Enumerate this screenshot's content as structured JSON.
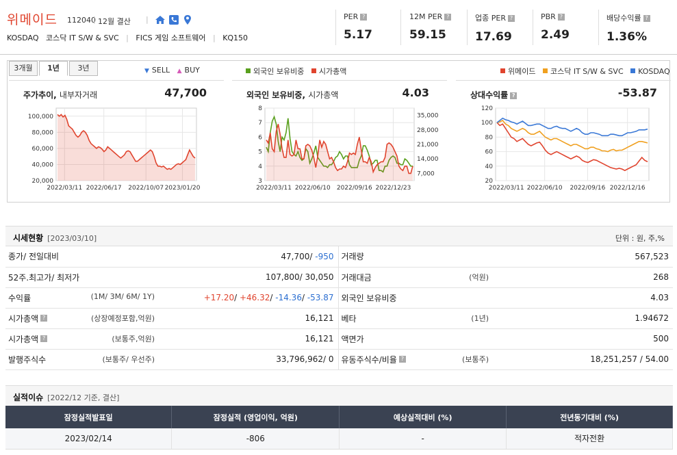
{
  "company": {
    "name": "위메이드",
    "code": "112040",
    "fiscal": "12월 결산",
    "market": "KOSDAQ",
    "industry": "코스닥 IT S/W & SVC",
    "fics": "FICS 게임 소프트웨어",
    "index": "KQ150"
  },
  "icons": [
    "home-icon",
    "phone-icon",
    "location-pin-icon",
    "help-icon"
  ],
  "metrics": [
    {
      "label": "PER",
      "value": "5.17"
    },
    {
      "label": "12M PER",
      "value": "59.15"
    },
    {
      "label": "업종 PER",
      "value": "17.69"
    },
    {
      "label": "PBR",
      "value": "2.49"
    },
    {
      "label": "배당수익률",
      "value": "1.36%"
    }
  ],
  "tabs": [
    "3개월",
    "1년",
    "3년"
  ],
  "active_tab": "1년",
  "legends": {
    "trade": [
      "SELL",
      "BUY"
    ],
    "foreign": [
      "외국인 보유비중",
      "시가총액"
    ],
    "relative": [
      "위메이드",
      "코스닥 IT S/W & SVC",
      "KOSDAQ"
    ]
  },
  "colors": {
    "red": "#e0442e",
    "green": "#5aa01e",
    "orange": "#f0a020",
    "blue": "#3a78d6",
    "sell": "#3a78d6",
    "buy": "#d65ab8"
  },
  "chart_data": [
    {
      "type": "area",
      "title": "주가추이",
      "subtitle": "내부자거래",
      "headline": "47,700",
      "x_ticks": [
        "2022/03/11",
        "2022/06/17",
        "2022/10/07",
        "2023/01/20"
      ],
      "y_ticks": [
        "100,000",
        "80,000",
        "60,000",
        "40,000",
        "20,000"
      ],
      "ylim": [
        20000,
        110000
      ],
      "series": [
        {
          "name": "위메이드",
          "values": [
            102000,
            100000,
            102000,
            99000,
            101000,
            96000,
            88000,
            86000,
            84000,
            80000,
            76000,
            74000,
            76000,
            80000,
            82000,
            80000,
            76000,
            70000,
            66000,
            64000,
            62000,
            60000,
            62000,
            61000,
            59000,
            56000,
            58000,
            62000,
            60000,
            58000,
            56000,
            54000,
            52000,
            50000,
            48000,
            50000,
            52000,
            56000,
            57000,
            56000,
            52000,
            48000,
            44000,
            44000,
            46000,
            48000,
            50000,
            52000,
            54000,
            56000,
            58000,
            56000,
            50000,
            42000,
            38000,
            38000,
            37000,
            38000,
            36000,
            34000,
            35000,
            34000,
            36000,
            38000,
            40000,
            41000,
            40000,
            42000,
            44000,
            46000,
            52000,
            58000,
            54000,
            50000,
            48000
          ]
        }
      ]
    },
    {
      "type": "line",
      "title": "외국인 보유비중",
      "subtitle": "시가총액",
      "headline": "4.03",
      "x_ticks": [
        "2022/03/11",
        "2022/06/10",
        "2022/09/16",
        "2022/12/23"
      ],
      "y_ticks": [
        "8",
        "7",
        "6",
        "5",
        "4",
        "3"
      ],
      "y2_ticks": [
        "35,000",
        "28,000",
        "21,000",
        "14,000",
        "7,000"
      ],
      "ylim": [
        3,
        8
      ],
      "series": [
        {
          "name": "외국인 보유비중",
          "values": [
            5.3,
            5.0,
            6.3,
            7.1,
            7.4,
            6.9,
            5.7,
            5.0,
            6.0,
            5.8,
            6.3,
            7.3,
            5.9,
            5.0,
            4.8,
            4.7,
            5.0,
            4.6,
            4.4,
            4.5,
            5.2,
            5.0,
            4.2,
            4.5,
            4.9,
            5.4,
            4.6,
            4.4,
            4.2,
            4.0,
            4.0,
            3.9,
            4.1,
            4.1,
            4.3,
            4.6,
            4.7,
            5.0,
            4.8,
            4.5,
            4.7,
            4.7,
            4.1,
            3.9,
            3.9,
            3.9,
            3.9,
            4.4,
            4.7,
            5.4,
            5.4,
            5.1,
            4.7,
            4.1,
            4.2,
            4.4,
            4.4,
            3.7,
            3.7,
            3.6,
            4.0,
            4.0,
            4.4,
            4.6,
            4.7,
            4.6,
            4.2,
            4.2,
            4.1,
            4.1,
            4.5,
            4.4,
            4.2,
            4.0,
            4.0
          ]
        },
        {
          "name": "시가총액",
          "values": [
            5.8,
            5.6,
            6.3,
            5.2,
            5.0,
            6.4,
            6.9,
            6.2,
            5.2,
            4.6,
            4.6,
            5.8,
            4.8,
            4.7,
            4.8,
            5.8,
            5.2,
            5.2,
            4.5,
            4.5,
            5.4,
            5.5,
            5.4,
            5.1,
            4.6,
            3.9,
            4.7,
            5.8,
            5.3,
            5.7,
            5.5,
            5.0,
            4.5,
            4.6,
            4.3,
            3.9,
            3.7,
            3.8,
            3.8,
            4.0,
            3.9,
            4.3,
            4.9,
            4.8,
            4.9,
            4.8,
            5.5,
            6.0,
            5.1,
            4.3,
            4.3,
            4.2,
            4.6,
            4.3,
            3.6,
            3.9,
            4.1,
            4.2,
            4.3,
            4.3,
            4.6,
            5.5,
            5.6,
            5.5,
            5.3,
            5.0,
            4.7,
            4.0,
            3.8,
            3.7,
            4.0,
            4.0,
            3.5,
            3.5,
            4.0
          ]
        }
      ]
    },
    {
      "type": "line",
      "title": "상대수익률",
      "headline": "-53.87",
      "x_ticks": [
        "2022/03/11",
        "2022/06/10",
        "2022/09/16",
        "2022/12/16"
      ],
      "y_ticks": [
        "120",
        "100",
        "80",
        "60",
        "40",
        "20"
      ],
      "ylim": [
        20,
        120
      ],
      "series": [
        {
          "name": "위메이드",
          "values": [
            100,
            96,
            98,
            92,
            86,
            80,
            78,
            74,
            76,
            78,
            74,
            70,
            68,
            70,
            72,
            73,
            68,
            62,
            58,
            56,
            58,
            60,
            58,
            56,
            54,
            52,
            50,
            52,
            54,
            52,
            48,
            46,
            45,
            47,
            49,
            48,
            46,
            44,
            42,
            40,
            38,
            37,
            36,
            37,
            36,
            34,
            36,
            38,
            40,
            42,
            47,
            52,
            48,
            46
          ]
        },
        {
          "name": "코스닥 IT S/W & SVC",
          "values": [
            100,
            101,
            103,
            98,
            96,
            92,
            90,
            88,
            90,
            92,
            90,
            86,
            84,
            84,
            86,
            88,
            84,
            80,
            78,
            76,
            78,
            78,
            76,
            74,
            72,
            70,
            68,
            70,
            70,
            68,
            66,
            64,
            64,
            66,
            66,
            64,
            63,
            61,
            61,
            60,
            62,
            63,
            61,
            62,
            62,
            64,
            66,
            68,
            70,
            72,
            74,
            74,
            73,
            72
          ]
        },
        {
          "name": "KOSDAQ",
          "values": [
            100,
            103,
            106,
            104,
            103,
            101,
            100,
            98,
            100,
            102,
            99,
            96,
            96,
            97,
            98,
            98,
            96,
            94,
            92,
            92,
            94,
            95,
            93,
            92,
            92,
            90,
            88,
            90,
            92,
            90,
            86,
            84,
            84,
            86,
            86,
            85,
            84,
            82,
            82,
            82,
            84,
            84,
            83,
            82,
            82,
            84,
            86,
            86,
            87,
            88,
            90,
            90,
            90,
            91
          ]
        }
      ]
    }
  ],
  "market_status": {
    "title": "시세현황",
    "date": "[2023/03/10]",
    "unit": "단위 : 원, 주,%",
    "rows": [
      {
        "l_label": "종가/ 전일대비",
        "l_sub": "",
        "l_val_main": "47,700/",
        "l_val_extra": " -950",
        "r_label": "거래량",
        "r_sub": "",
        "r_val": "567,523"
      },
      {
        "l_label": "52주.최고가/ 최저가",
        "l_sub": "",
        "l_val_main": "107,800/ 30,050",
        "l_val_extra": "",
        "r_label": "거래대금",
        "r_sub": "(억원)",
        "r_val": "268"
      },
      {
        "l_label": "수익률",
        "l_sub": "(1M/ 3M/ 6M/ 1Y)",
        "returns": [
          "+17.20",
          "+46.32",
          "-14.36",
          "-53.87"
        ],
        "r_label": "외국인 보유비중",
        "r_sub": "",
        "r_val": "4.03"
      },
      {
        "l_label": "시가총액",
        "l_sub": "(상장예정포함,억원)",
        "l_val_main": "16,121",
        "l_val_extra": "",
        "r_label": "베타",
        "r_sub": "(1년)",
        "r_val": "1.94672"
      },
      {
        "l_label": "시가총액",
        "l_sub": "(보통주,억원)",
        "l_val_main": "16,121",
        "l_val_extra": "",
        "r_label": "액면가",
        "r_sub": "",
        "r_val": "500"
      },
      {
        "l_label": "발행주식수",
        "l_sub": "(보통주/ 우선주)",
        "l_val_main": "33,796,962/ 0",
        "l_val_extra": "",
        "r_label": "유동주식수/비율",
        "r_sub": "(보통주)",
        "r_val": "18,251,257 / 54.00"
      }
    ]
  },
  "earnings": {
    "title": "실적이슈",
    "date": "[2022/12 기준, 결산]",
    "headers": [
      "잠정실적발표일",
      "잠정실적 (영업이익, 억원)",
      "예상실적대비 (%)",
      "전년동기대비 (%)"
    ],
    "row": [
      "2023/02/14",
      "-806",
      "-",
      "적자전환"
    ]
  }
}
